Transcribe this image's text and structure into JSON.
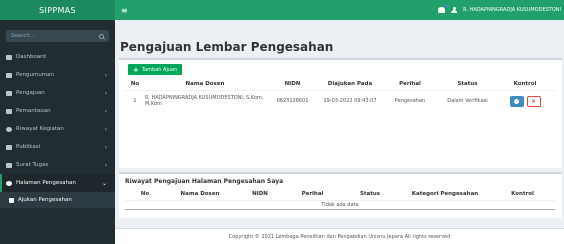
{
  "brand": "SIPPMAS",
  "header": {
    "toggle_glyph": "≡",
    "user_name": "R. HADAPNINGRADJA KUSUMODESTONI",
    "notification_icon": "bell-icon",
    "user_icon": "user-icon"
  },
  "sidebar": {
    "search_placeholder": "Search...",
    "items": [
      {
        "label": "Dashboard",
        "icon": "dashboard-icon"
      },
      {
        "label": "Pengumuman",
        "icon": "bullhorn-icon",
        "chevron": "‹"
      },
      {
        "label": "Pengajuan",
        "icon": "file-icon",
        "chevron": "‹"
      },
      {
        "label": "Pemantauan",
        "icon": "monitor-icon",
        "chevron": "‹"
      },
      {
        "label": "Riwayat Kegiatan",
        "icon": "history-icon",
        "chevron": "‹"
      },
      {
        "label": "Publikasi",
        "icon": "book-icon",
        "chevron": "‹"
      },
      {
        "label": "Surat Tugas",
        "icon": "mail-icon",
        "chevron": "‹"
      },
      {
        "label": "Halaman Pengesahan",
        "icon": "check-circle-icon",
        "chevron": "⌄"
      }
    ],
    "sub_items": [
      {
        "label": "Ajukan Pengesahan",
        "icon": "file-icon"
      }
    ]
  },
  "main": {
    "title": "Pengajuan Lembar Pengesahan",
    "add_button": "Tambah Ajuan",
    "table1": {
      "headers": [
        "No",
        "Nama Dosen",
        "NIDN",
        "Diajukan Pada",
        "Perihal",
        "Status",
        "Kontrol"
      ],
      "rows": [
        {
          "no": "1",
          "nama": "R. HADAPNINGRADJA KUSUMODESTONI, S.Kom, M.Kom",
          "nidn": "0623128601",
          "diajukan": "19-03-2022 09:43:07",
          "perihal": "Pengesahan",
          "status": "Dalam Verifikasi",
          "delete_glyph": "×"
        }
      ]
    },
    "table2": {
      "title": "Riwayat Pengajuan Halaman Pengesahan Saya",
      "headers": [
        "No",
        "Nama Dosen",
        "NIDN",
        "Perihal",
        "Status",
        "Kategori Pengesahan",
        "Kontrol"
      ],
      "empty": "Tidak ada data"
    }
  },
  "footer": "Copyright © 2021 Lembaga Penelitian dan Pengabdian Unisnu Jepara All rights reserved"
}
